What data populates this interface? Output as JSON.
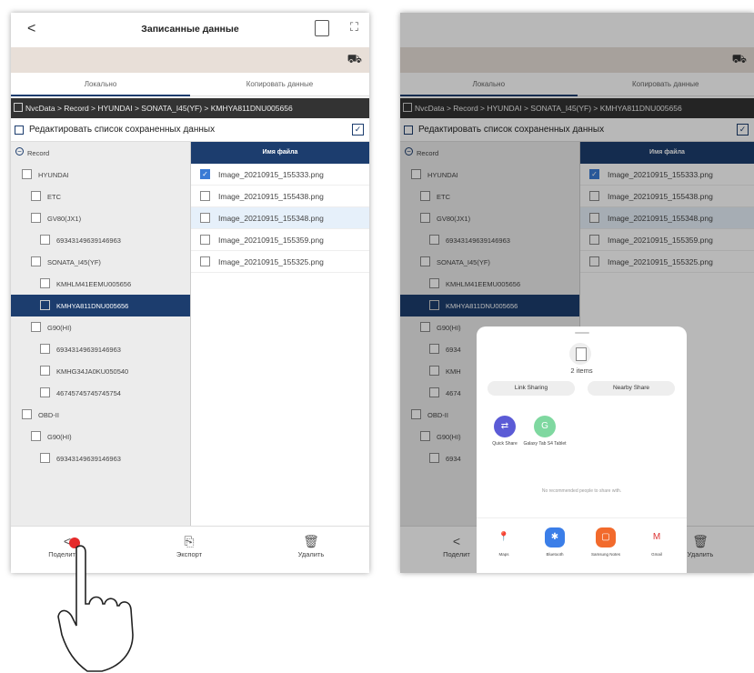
{
  "header": {
    "back": "<",
    "title": "Записанные данные"
  },
  "tabs": {
    "local": "Локально",
    "copy": "Копировать данные"
  },
  "path": "NvcData > Record > HYUNDAI > SONATA_I45(YF) > KMHYA811DNU005656",
  "edit_label": "Редактировать список сохраненных данных",
  "tree": [
    {
      "label": "Record",
      "level": 0,
      "type": "root"
    },
    {
      "label": "HYUNDAI",
      "level": 1
    },
    {
      "label": "ETC",
      "level": 2
    },
    {
      "label": "GV80(JX1)",
      "level": 2
    },
    {
      "label": "69343149639146963",
      "level": 3
    },
    {
      "label": "SONATA_I45(YF)",
      "level": 2
    },
    {
      "label": "KMHLM41EEMU005656",
      "level": 3
    },
    {
      "label": "KMHYA811DNU005656",
      "level": 3,
      "selected": true
    },
    {
      "label": "G90(HI)",
      "level": 2
    },
    {
      "label": "69343149639146963",
      "level": 3
    },
    {
      "label": "KMHG34JA0KU050540",
      "level": 3
    },
    {
      "label": "46745745745745754",
      "level": 3
    },
    {
      "label": "OBD-II",
      "level": 1
    },
    {
      "label": "G90(HI)",
      "level": 2
    },
    {
      "label": "69343149639146963",
      "level": 3
    }
  ],
  "tree2": [
    {
      "label": "Record",
      "level": 0,
      "type": "root"
    },
    {
      "label": "HYUNDAI",
      "level": 1
    },
    {
      "label": "ETC",
      "level": 2
    },
    {
      "label": "GV80(JX1)",
      "level": 2
    },
    {
      "label": "69343149639146963",
      "level": 3
    },
    {
      "label": "SONATA_I45(YF)",
      "level": 2
    },
    {
      "label": "KMHLM41EEMU005656",
      "level": 3
    },
    {
      "label": "KMHYA811DNU005656",
      "level": 3,
      "selected": true
    },
    {
      "label": "G90(HI)",
      "level": 2
    },
    {
      "label": "6934",
      "level": 3
    },
    {
      "label": "KMH",
      "level": 3
    },
    {
      "label": "4674",
      "level": 3
    },
    {
      "label": "OBD-II",
      "level": 1
    },
    {
      "label": "G90(HI)",
      "level": 2
    },
    {
      "label": "6934",
      "level": 3
    }
  ],
  "files_header": "Имя файла",
  "files": [
    {
      "name": "Image_20210915_155333.png",
      "checked": true
    },
    {
      "name": "Image_20210915_155438.png",
      "checked": false
    },
    {
      "name": "Image_20210915_155348.png",
      "checked": false,
      "highlight": true
    },
    {
      "name": "Image_20210915_155359.png",
      "checked": false
    },
    {
      "name": "Image_20210915_155325.png",
      "checked": false
    }
  ],
  "bottom": {
    "share": "Поделиться",
    "export": "Экспорт",
    "delete": "Удалить"
  },
  "bottom2": {
    "share": "Поделит",
    "delete": "Удалить"
  },
  "share_sheet": {
    "items": "2 items",
    "link_sharing": "Link Sharing",
    "nearby_share": "Nearby Share",
    "apps": [
      {
        "name": "Quick Share",
        "color": "#5b5bd6",
        "glyph": "⇄"
      },
      {
        "name": "Galaxy Tab S4 Tablet",
        "color": "#7fd8a0",
        "glyph": "G"
      }
    ],
    "no_people": "No recommended people to share with.",
    "dock": [
      {
        "name": "Maps",
        "color": "#fff",
        "glyph": "📍"
      },
      {
        "name": "Bluetooth",
        "color": "#3b7ee8",
        "glyph": "✱"
      },
      {
        "name": "Samsung Notes",
        "color": "#f26a2c",
        "glyph": "▢"
      },
      {
        "name": "Gmail",
        "color": "#fff",
        "glyph": "M"
      }
    ]
  },
  "colors": {
    "accent": "#1c3d6e",
    "car_bar": "#e8dfd8",
    "path_bar": "#333333",
    "checkbox_on": "#3a7bd5"
  }
}
